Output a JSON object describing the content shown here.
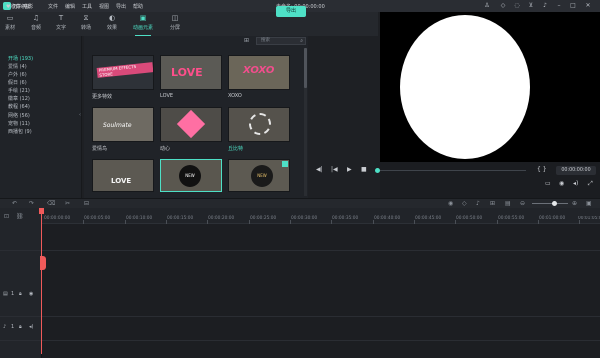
{
  "app": {
    "name": "万兴喵影",
    "project_title": "未命名: 00:00:00:00",
    "menu": [
      "文件",
      "编辑",
      "工具",
      "视图",
      "导出",
      "帮助"
    ],
    "window_icons": [
      "user-icon",
      "cart-icon",
      "notification-icon",
      "download-icon",
      "mic-icon",
      "minimize-icon",
      "maximize-icon",
      "close-icon"
    ]
  },
  "toolbar": {
    "tools": [
      {
        "label": "素材",
        "icon": "folder-icon"
      },
      {
        "label": "音频",
        "icon": "music-icon"
      },
      {
        "label": "文字",
        "icon": "text-icon"
      },
      {
        "label": "转场",
        "icon": "transition-icon"
      },
      {
        "label": "效果",
        "icon": "effects-icon"
      },
      {
        "label": "动画元素",
        "icon": "elements-icon"
      },
      {
        "label": "分屏",
        "icon": "splitscreen-icon"
      }
    ],
    "active_tool": "动画元素",
    "export_label": "导出"
  },
  "categories": {
    "header": "♥收藏 (0)",
    "items": [
      "开场 (193)",
      "爱情 (4)",
      "户外 (6)",
      "假日 (6)",
      "手绘 (21)",
      "徽章 (12)",
      "教程 (64)",
      "网络 (56)",
      "宠物 (11)",
      "西播包 (9)"
    ],
    "active_index": 0
  },
  "library": {
    "search_placeholder": "搜索",
    "items": [
      {
        "label": "更多特效",
        "art": "PREMIUM EFFECTS STORE"
      },
      {
        "label": "LOVE",
        "art": "LOVE"
      },
      {
        "label": "XOXO",
        "art": "XOXO"
      },
      {
        "label": "爱情鸟",
        "art": "Soulmate"
      },
      {
        "label": "动心",
        "art": ""
      },
      {
        "label": "丘比特",
        "art": ""
      },
      {
        "label": "",
        "art": "LOVE"
      },
      {
        "label": "",
        "art": "NEW"
      },
      {
        "label": "",
        "art": "NEW"
      }
    ]
  },
  "preview": {
    "timecode": "00:00:00:00",
    "brackets": "{ }"
  },
  "timeline": {
    "ticks": [
      "00:00:00:00",
      "00:00:05:00",
      "00:00:10:00",
      "00:00:15:00",
      "00:00:20:00",
      "00:00:25:00",
      "00:00:30:00",
      "00:00:35:00",
      "00:00:40:00",
      "00:00:45:00",
      "00:00:50:00",
      "00:00:55:00",
      "00:01:00:00",
      "00:01:05:00"
    ],
    "tracks": [
      {
        "name": "1",
        "icon": "video-track-icon"
      },
      {
        "name": "1",
        "icon": "audio-track-icon"
      }
    ]
  }
}
